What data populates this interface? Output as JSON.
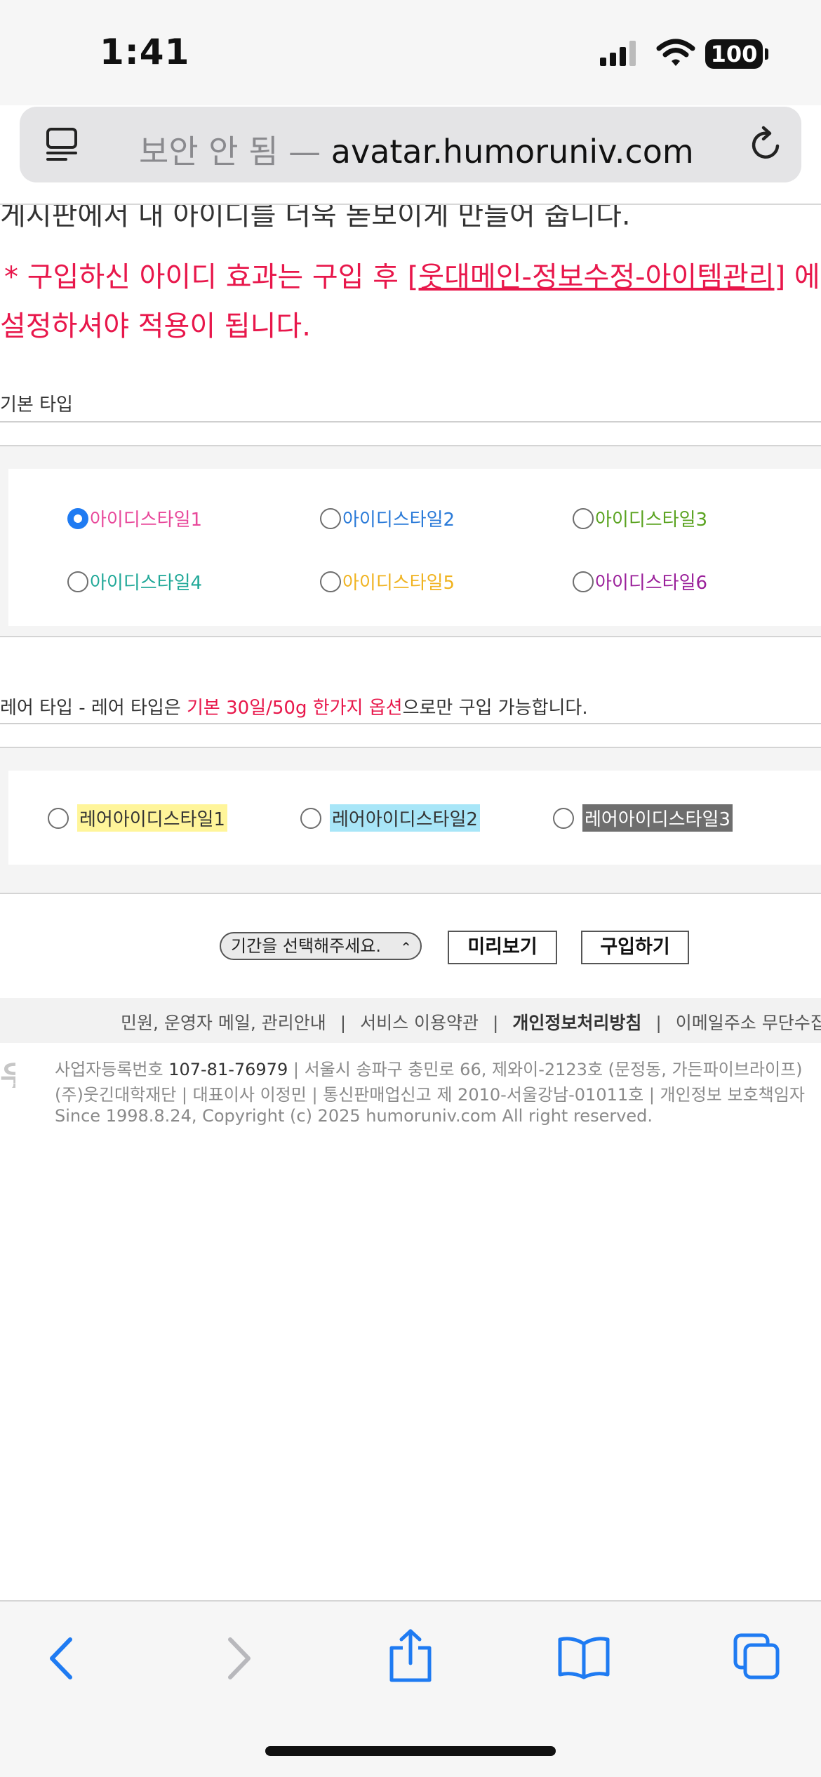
{
  "status_bar": {
    "time": "1:41",
    "battery": "100"
  },
  "url_bar": {
    "insecure_label": "보안 안 됨 —",
    "domain": "avatar.humoruniv.com"
  },
  "page": {
    "cut_top_text": "게시판에서 내 아이디를 더욱 돋보이게 만들어 줍니다.",
    "notice_line1_prefix": "* 구입하신 아이디 효과는 구입 후 ",
    "notice_link": "[웃대메인-정보수정-아이템관리]",
    "notice_line1_suffix": " 에",
    "notice_line2": "설정하셔야 적용이 됩니다.",
    "basic_section_title": "기본 타입",
    "basic_options": [
      {
        "label": "아이디스타일1",
        "color": "#e8489a",
        "checked": true
      },
      {
        "label": "아이디스타일2",
        "color": "#2a7ad8",
        "checked": false
      },
      {
        "label": "아이디스타일3",
        "color": "#5aa320",
        "checked": false
      },
      {
        "label": "아이디스타일4",
        "color": "#20a898",
        "checked": false
      },
      {
        "label": "아이디스타일5",
        "color": "#f0b320",
        "checked": false
      },
      {
        "label": "아이디스타일6",
        "color": "#9a1f9a",
        "checked": false
      }
    ],
    "rare_section_title_prefix": "레어 타입 - 레어 타입은 ",
    "rare_section_title_highlight": "기본 30일/50g 한가지 옵션",
    "rare_section_title_suffix": "으로만 구입 가능합니다.",
    "rare_options": [
      {
        "label": "레어아이디스타일1",
        "bg": "#fff59a",
        "fg": "#333333"
      },
      {
        "label": "레어아이디스타일2",
        "bg": "#a8e6f8",
        "fg": "#333333"
      },
      {
        "label": "레어아이디스타일3",
        "bg": "#6e6e6e",
        "fg": "#ffffff"
      }
    ],
    "period_select": "기간을 선택해주세요.",
    "preview_button": "미리보기",
    "buy_button": "구입하기"
  },
  "footer": {
    "link1": "민원, 운영자 메일, 관리안내",
    "link2": "서비스 이용약관",
    "link3": "개인정보처리방침",
    "link4": "이메일주소 무단수집거부",
    "sep": "|",
    "reg_label": "사업자등록번호",
    "reg_number": "107-81-76979",
    "address": "| 서울시 송파구 충민로 66, 제와이-2123호 (문정동, 가든파이브라이프)",
    "line2": "(주)웃긴대학재단 | 대표이사 이정민 | 통신판매업신고 제 2010-서울강남-01011호 | 개인정보 보호책임자",
    "line3": "Since 1998.8.24, Copyright (c) 2025 humoruniv.com All right reserved.",
    "logo_char": "웃"
  },
  "toolbar": {
    "back_icon": "chevron-left-icon",
    "forward_icon": "chevron-right-icon",
    "share_icon": "share-icon",
    "bookmarks_icon": "book-icon",
    "tabs_icon": "tabs-icon"
  },
  "colors": {
    "accent_blue": "#1f7bf2",
    "notice_red": "#e8174b"
  }
}
